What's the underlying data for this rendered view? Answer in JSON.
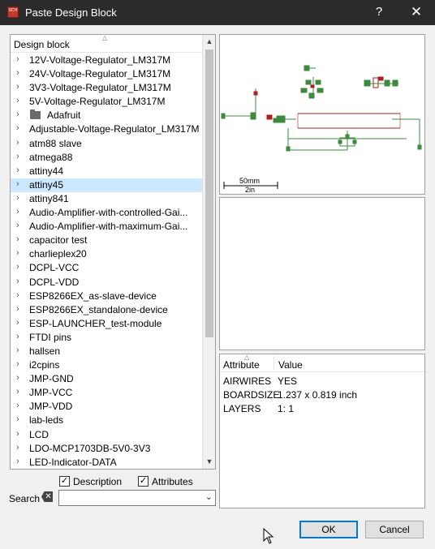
{
  "window": {
    "title": "Paste Design Block",
    "app_icon_text": "SCH",
    "help_label": "?",
    "close_label": "✕"
  },
  "tree": {
    "header": "Design block",
    "selected_index": 9,
    "items": [
      {
        "label": "12V-Voltage-Regulator_LM317M",
        "folder": false
      },
      {
        "label": "24V-Voltage-Regulator_LM317M",
        "folder": false
      },
      {
        "label": "3V3-Voltage-Regulator_LM317M",
        "folder": false
      },
      {
        "label": "5V-Voltage-Regulator_LM317M",
        "folder": false
      },
      {
        "label": "Adafruit",
        "folder": true
      },
      {
        "label": "Adjustable-Voltage-Regulator_LM317M",
        "folder": false
      },
      {
        "label": "atm88 slave",
        "folder": false
      },
      {
        "label": "atmega88",
        "folder": false
      },
      {
        "label": "attiny44",
        "folder": false
      },
      {
        "label": "attiny45",
        "folder": false
      },
      {
        "label": "attiny841",
        "folder": false
      },
      {
        "label": "Audio-Amplifier-with-controlled-Gai...",
        "folder": false
      },
      {
        "label": "Audio-Amplifier-with-maximum-Gai...",
        "folder": false
      },
      {
        "label": "capacitor test",
        "folder": false
      },
      {
        "label": "charlieplex20",
        "folder": false
      },
      {
        "label": "DCPL-VCC",
        "folder": false
      },
      {
        "label": "DCPL-VDD",
        "folder": false
      },
      {
        "label": "ESP8266EX_as-slave-device",
        "folder": false
      },
      {
        "label": "ESP8266EX_standalone-device",
        "folder": false
      },
      {
        "label": "ESP-LAUNCHER_test-module",
        "folder": false
      },
      {
        "label": "FTDI pins",
        "folder": false
      },
      {
        "label": "hallsen",
        "folder": false
      },
      {
        "label": "i2cpins",
        "folder": false
      },
      {
        "label": "JMP-GND",
        "folder": false
      },
      {
        "label": "JMP-VCC",
        "folder": false
      },
      {
        "label": "JMP-VDD",
        "folder": false
      },
      {
        "label": "lab-leds",
        "folder": false
      },
      {
        "label": "LCD",
        "folder": false
      },
      {
        "label": "LDO-MCP1703DB-5V0-3V3",
        "folder": false
      },
      {
        "label": "LED-Indicator-DATA",
        "folder": false
      }
    ]
  },
  "options": {
    "description_label": "Description",
    "description_checked": true,
    "attributes_label": "Attributes",
    "attributes_checked": true
  },
  "search": {
    "label": "Search",
    "value": ""
  },
  "preview": {
    "scale_label_top": "50mm",
    "scale_label_bottom": "2in"
  },
  "attributes": {
    "col_attribute": "Attribute",
    "col_value": "Value",
    "rows": [
      {
        "key": "AIRWIRES",
        "value": "YES"
      },
      {
        "key": "BOARDSIZE",
        "value": "1.237 x 0.819 inch"
      },
      {
        "key": "LAYERS",
        "value": "1: 1"
      }
    ]
  },
  "buttons": {
    "ok": "OK",
    "cancel": "Cancel"
  },
  "colors": {
    "titlebar": "#2b2b2b",
    "selection": "#cce8ff",
    "pcb_green": "#3c8a3c",
    "pcb_red": "#b01e1e"
  }
}
